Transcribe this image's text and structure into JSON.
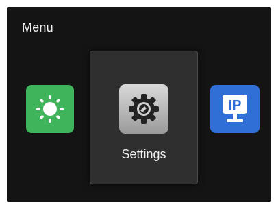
{
  "header": {
    "title": "Menu"
  },
  "menu": {
    "selected_label": "Settings",
    "ip_icon_text": "IP",
    "colors": {
      "brightness_tile": "#3fb45a",
      "ip_tile": "#2f6fd6",
      "background": "#141414",
      "panel": "#2f2f2f"
    },
    "icons": [
      "sun-icon",
      "gear-icon",
      "ip-monitor-icon"
    ]
  }
}
